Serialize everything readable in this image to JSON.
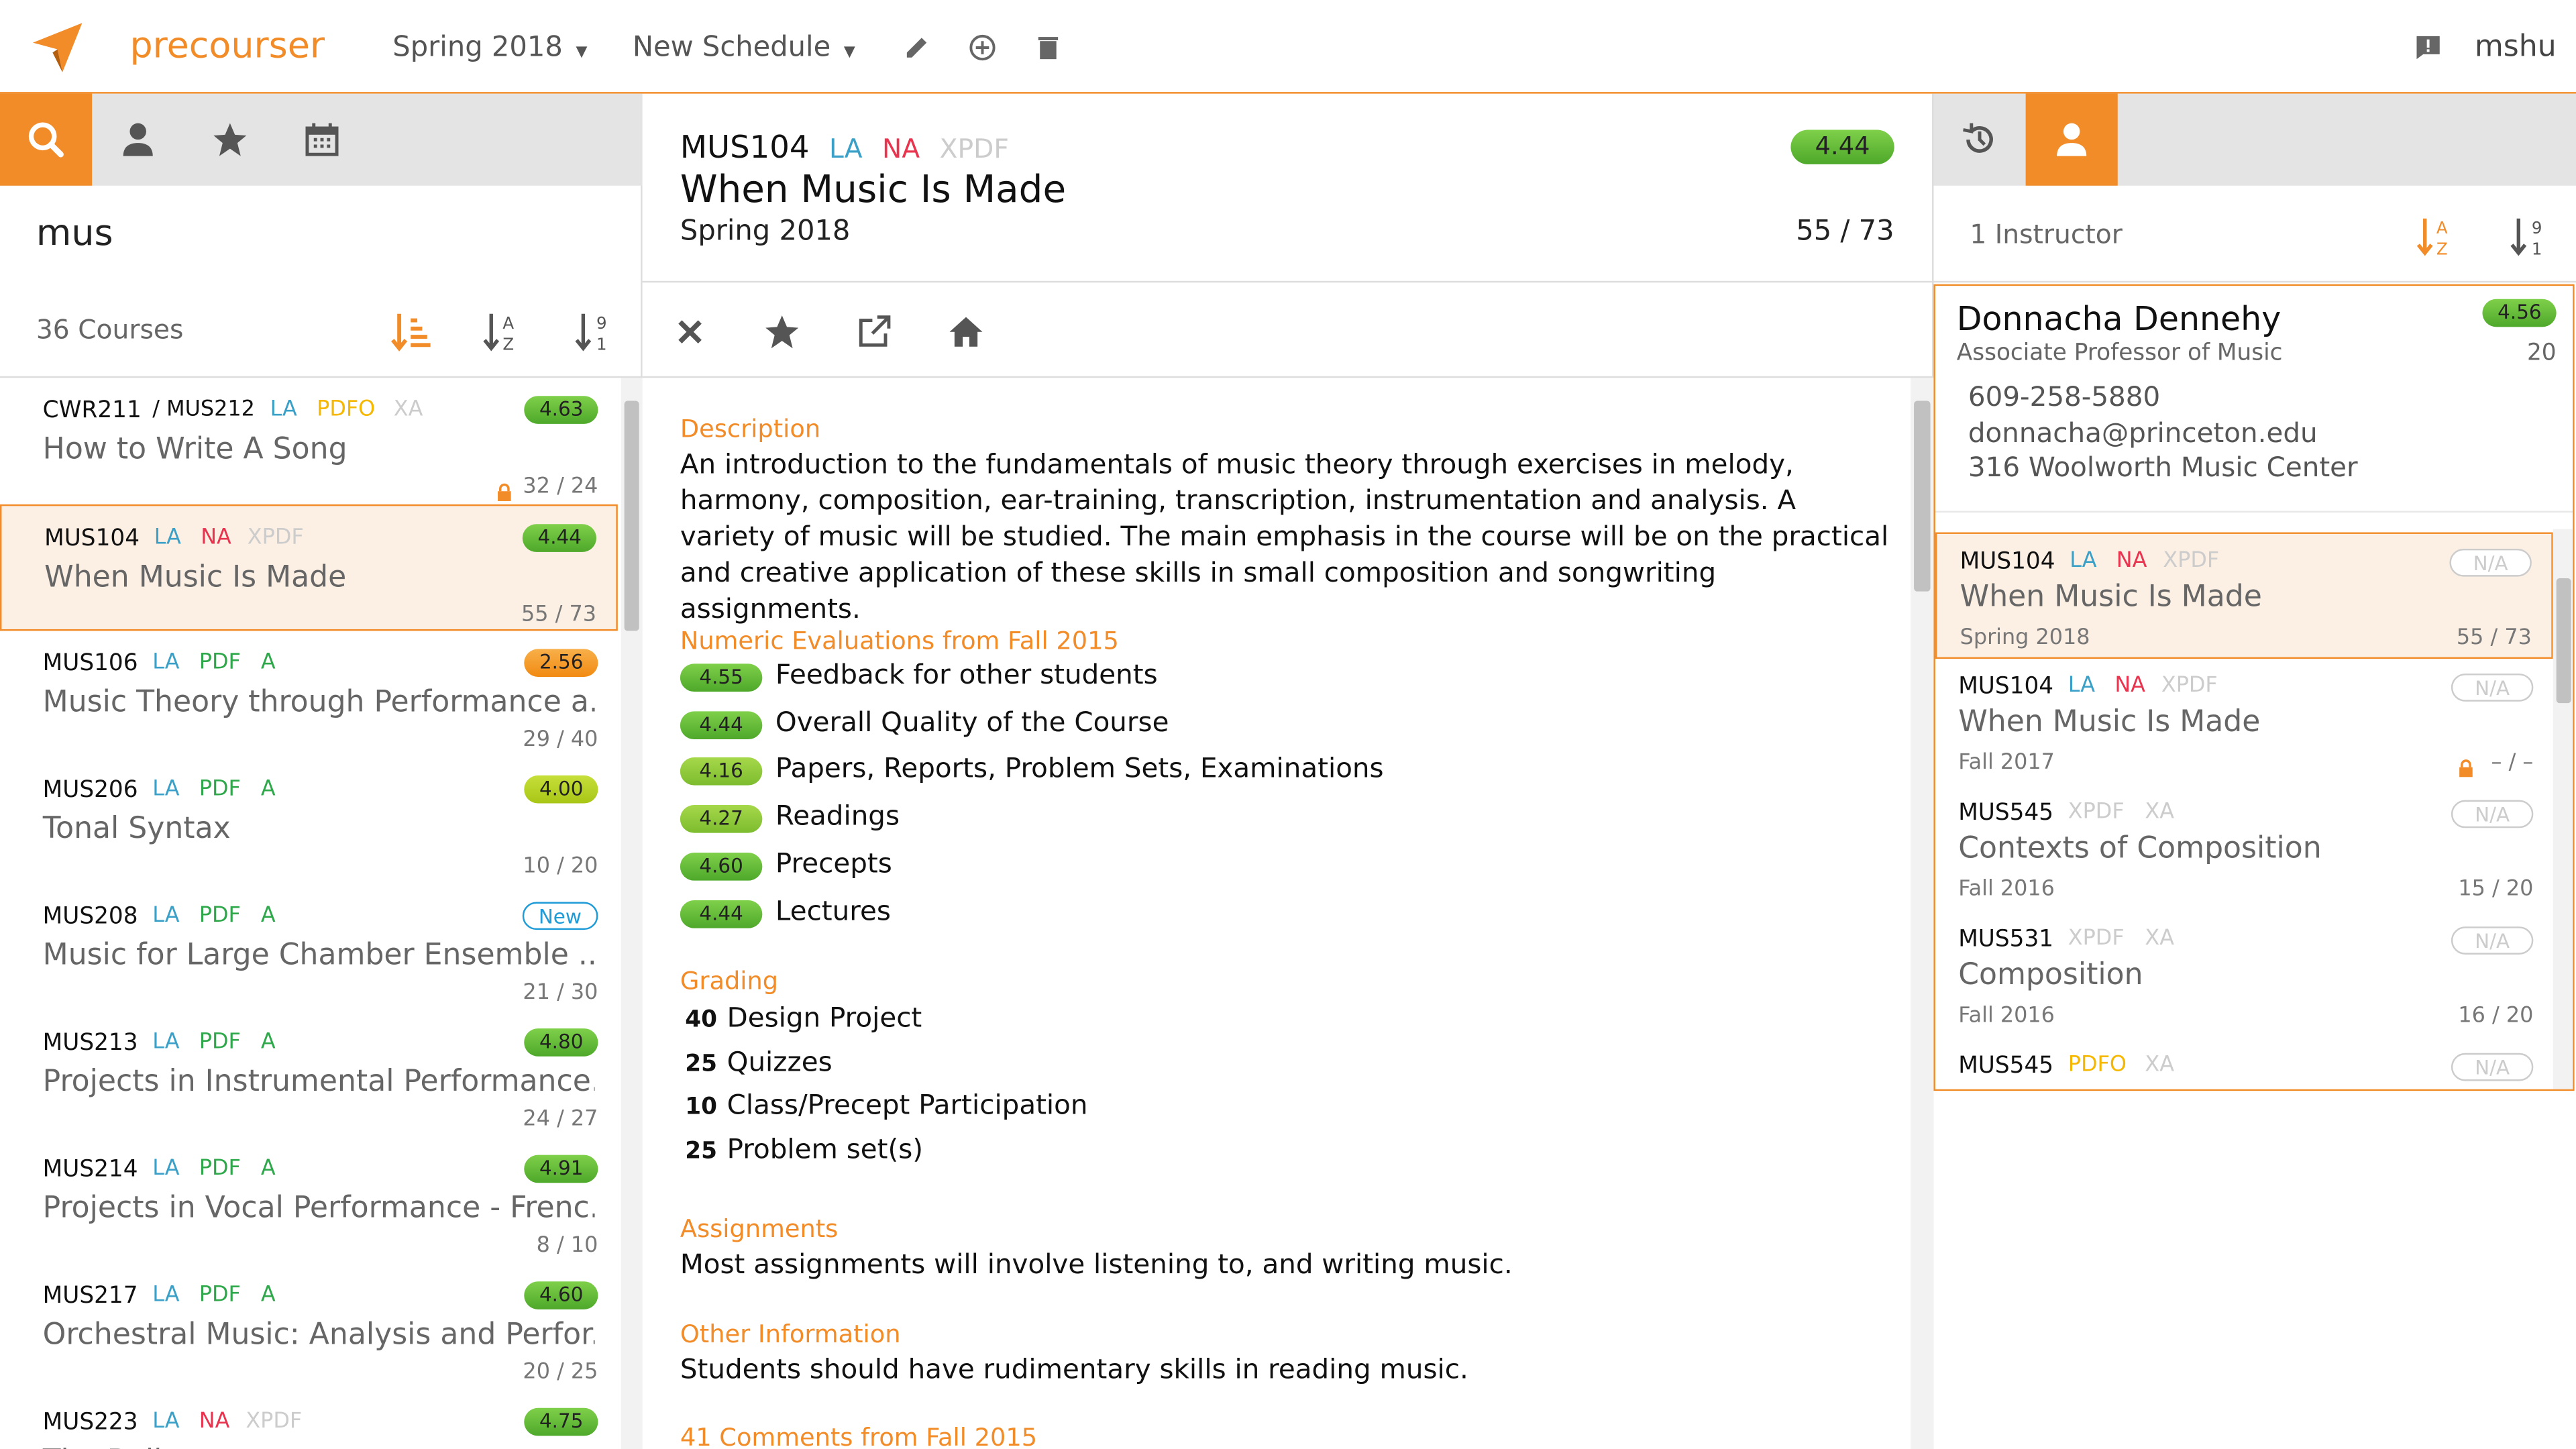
{
  "header": {
    "brand": "precourser",
    "term_select": "Spring 2018",
    "schedule_select": "New Schedule",
    "user": "mshu"
  },
  "left": {
    "search_value": "mus",
    "course_count": "36 Courses",
    "items": [
      {
        "code": "CWR211",
        "cross": "/ MUS212",
        "tags": [
          [
            "LA",
            "la"
          ],
          [
            "PDFO",
            "pdfo"
          ],
          [
            "XA",
            "xa"
          ]
        ],
        "title": "How to Write A Song",
        "badge": "4.63",
        "badge_class": "b-g",
        "enrollment": "32 / 24",
        "locked": true
      },
      {
        "code": "MUS104",
        "cross": "",
        "tags": [
          [
            "LA",
            "la"
          ],
          [
            "NA",
            "na"
          ],
          [
            "XPDF",
            "xpdf"
          ]
        ],
        "title": "When Music Is Made",
        "badge": "4.44",
        "badge_class": "b-g",
        "enrollment": "55 / 73",
        "locked": false,
        "selected": true
      },
      {
        "code": "MUS106",
        "cross": "",
        "tags": [
          [
            "LA",
            "la"
          ],
          [
            "PDF",
            "pdf"
          ],
          [
            "A",
            "a"
          ]
        ],
        "title": "Music Theory through Performance a...",
        "badge": "2.56",
        "badge_class": "b-o",
        "enrollment": "29 / 40",
        "locked": false
      },
      {
        "code": "MUS206",
        "cross": "",
        "tags": [
          [
            "LA",
            "la"
          ],
          [
            "PDF",
            "pdf"
          ],
          [
            "A",
            "a"
          ]
        ],
        "title": "Tonal Syntax",
        "badge": "4.00",
        "badge_class": "b-y",
        "enrollment": "10 / 20",
        "locked": false
      },
      {
        "code": "MUS208",
        "cross": "",
        "tags": [
          [
            "LA",
            "la"
          ],
          [
            "PDF",
            "pdf"
          ],
          [
            "A",
            "a"
          ]
        ],
        "title": "Music for Large Chamber Ensemble ...",
        "badge": "New",
        "badge_class": "b-new",
        "enrollment": "21 / 30",
        "locked": false
      },
      {
        "code": "MUS213",
        "cross": "",
        "tags": [
          [
            "LA",
            "la"
          ],
          [
            "PDF",
            "pdf"
          ],
          [
            "A",
            "a"
          ]
        ],
        "title": "Projects in Instrumental Performance...",
        "badge": "4.80",
        "badge_class": "b-g",
        "enrollment": "24 / 27",
        "locked": false
      },
      {
        "code": "MUS214",
        "cross": "",
        "tags": [
          [
            "LA",
            "la"
          ],
          [
            "PDF",
            "pdf"
          ],
          [
            "A",
            "a"
          ]
        ],
        "title": "Projects in Vocal Performance - Frenc...",
        "badge": "4.91",
        "badge_class": "b-g",
        "enrollment": "8 / 10",
        "locked": false
      },
      {
        "code": "MUS217",
        "cross": "",
        "tags": [
          [
            "LA",
            "la"
          ],
          [
            "PDF",
            "pdf"
          ],
          [
            "A",
            "a"
          ]
        ],
        "title": "Orchestral Music: Analysis and Perfor...",
        "badge": "4.60",
        "badge_class": "b-g",
        "enrollment": "20 / 25",
        "locked": false
      },
      {
        "code": "MUS223",
        "cross": "",
        "tags": [
          [
            "LA",
            "la"
          ],
          [
            "NA",
            "na"
          ],
          [
            "XPDF",
            "xpdf"
          ]
        ],
        "title": "The Ballet",
        "badge": "4.75",
        "badge_class": "b-g",
        "enrollment": "",
        "locked": false
      }
    ]
  },
  "middle": {
    "code": "MUS104",
    "tags": [
      [
        "LA",
        "la"
      ],
      [
        "NA",
        "na"
      ],
      [
        "XPDF",
        "xpdf"
      ]
    ],
    "title": "When Music Is Made",
    "term": "Spring 2018",
    "enrollment": "55 / 73",
    "rating": "4.44",
    "description_heading": "Description",
    "description": "An introduction to the fundamentals of music theory through exercises in melody, harmony, composition, ear-training, transcription, instrumentation and analysis. A variety of music will be studied. The main emphasis in the course will be on the practical and creative application of these skills in small composition and songwriting assignments.",
    "evaluations_heading": "Numeric Evaluations from Fall 2015",
    "evaluations": [
      {
        "score": "4.55",
        "label": "Feedback for other students"
      },
      {
        "score": "4.44",
        "label": "Overall Quality of the Course"
      },
      {
        "score": "4.16",
        "label": "Papers, Reports, Problem Sets, Examinations"
      },
      {
        "score": "4.27",
        "label": "Readings"
      },
      {
        "score": "4.60",
        "label": "Precepts"
      },
      {
        "score": "4.44",
        "label": "Lectures"
      }
    ],
    "grading_heading": "Grading",
    "grading": [
      {
        "pct": "40",
        "label": "Design Project"
      },
      {
        "pct": "25",
        "label": "Quizzes"
      },
      {
        "pct": "10",
        "label": "Class/Precept Participation"
      },
      {
        "pct": "25",
        "label": "Problem set(s)"
      }
    ],
    "assignments_heading": "Assignments",
    "assignments": "Most assignments will involve listening to, and writing music.",
    "other_heading": "Other Information",
    "other": "Students should have rudimentary skills in reading music.",
    "comments_heading": "41 Comments from Fall 2015"
  },
  "right": {
    "instructor_count": "1 Instructor",
    "name": "Donnacha Dennehy",
    "position": "Associate Professor of Music",
    "rating": "4.56",
    "count": "20",
    "phone": "609-258-5880",
    "email": "donnacha@princeton.edu",
    "office": "316 Woolworth Music Center",
    "courses": [
      {
        "code": "MUS104",
        "tags": [
          [
            "LA",
            "la"
          ],
          [
            "NA",
            "na"
          ],
          [
            "XPDF",
            "xpdf"
          ]
        ],
        "title": "When Music Is Made",
        "term": "Spring 2018",
        "enrollment": "55 / 73",
        "badge": "N/A",
        "selected": true,
        "locked": false
      },
      {
        "code": "MUS104",
        "tags": [
          [
            "LA",
            "la"
          ],
          [
            "NA",
            "na"
          ],
          [
            "XPDF",
            "xpdf"
          ]
        ],
        "title": "When Music Is Made",
        "term": "Fall 2017",
        "enrollment": "– / –",
        "badge": "N/A",
        "locked": true
      },
      {
        "code": "MUS545",
        "tags": [
          [
            "XPDF",
            "xpdf"
          ],
          [
            "XA",
            "xa"
          ]
        ],
        "title": "Contexts of Composition",
        "term": "Fall 2016",
        "enrollment": "15 / 20",
        "badge": "N/A",
        "locked": false
      },
      {
        "code": "MUS531",
        "tags": [
          [
            "XPDF",
            "xpdf"
          ],
          [
            "XA",
            "xa"
          ]
        ],
        "title": "Composition",
        "term": "Fall 2016",
        "enrollment": "16 / 20",
        "badge": "N/A",
        "locked": false
      },
      {
        "code": "MUS545",
        "tags": [
          [
            "PDFO",
            "pdfo"
          ],
          [
            "XA",
            "xa"
          ]
        ],
        "title": "",
        "term": "",
        "enrollment": "",
        "badge": "N/A",
        "locked": false
      }
    ]
  },
  "colors": {
    "accent": "#f28c28",
    "rating_green": "#5cb82e",
    "rating_orange": "#f18a12",
    "rating_yellow": "#b6d124",
    "new_blue": "#1f9bd7"
  }
}
